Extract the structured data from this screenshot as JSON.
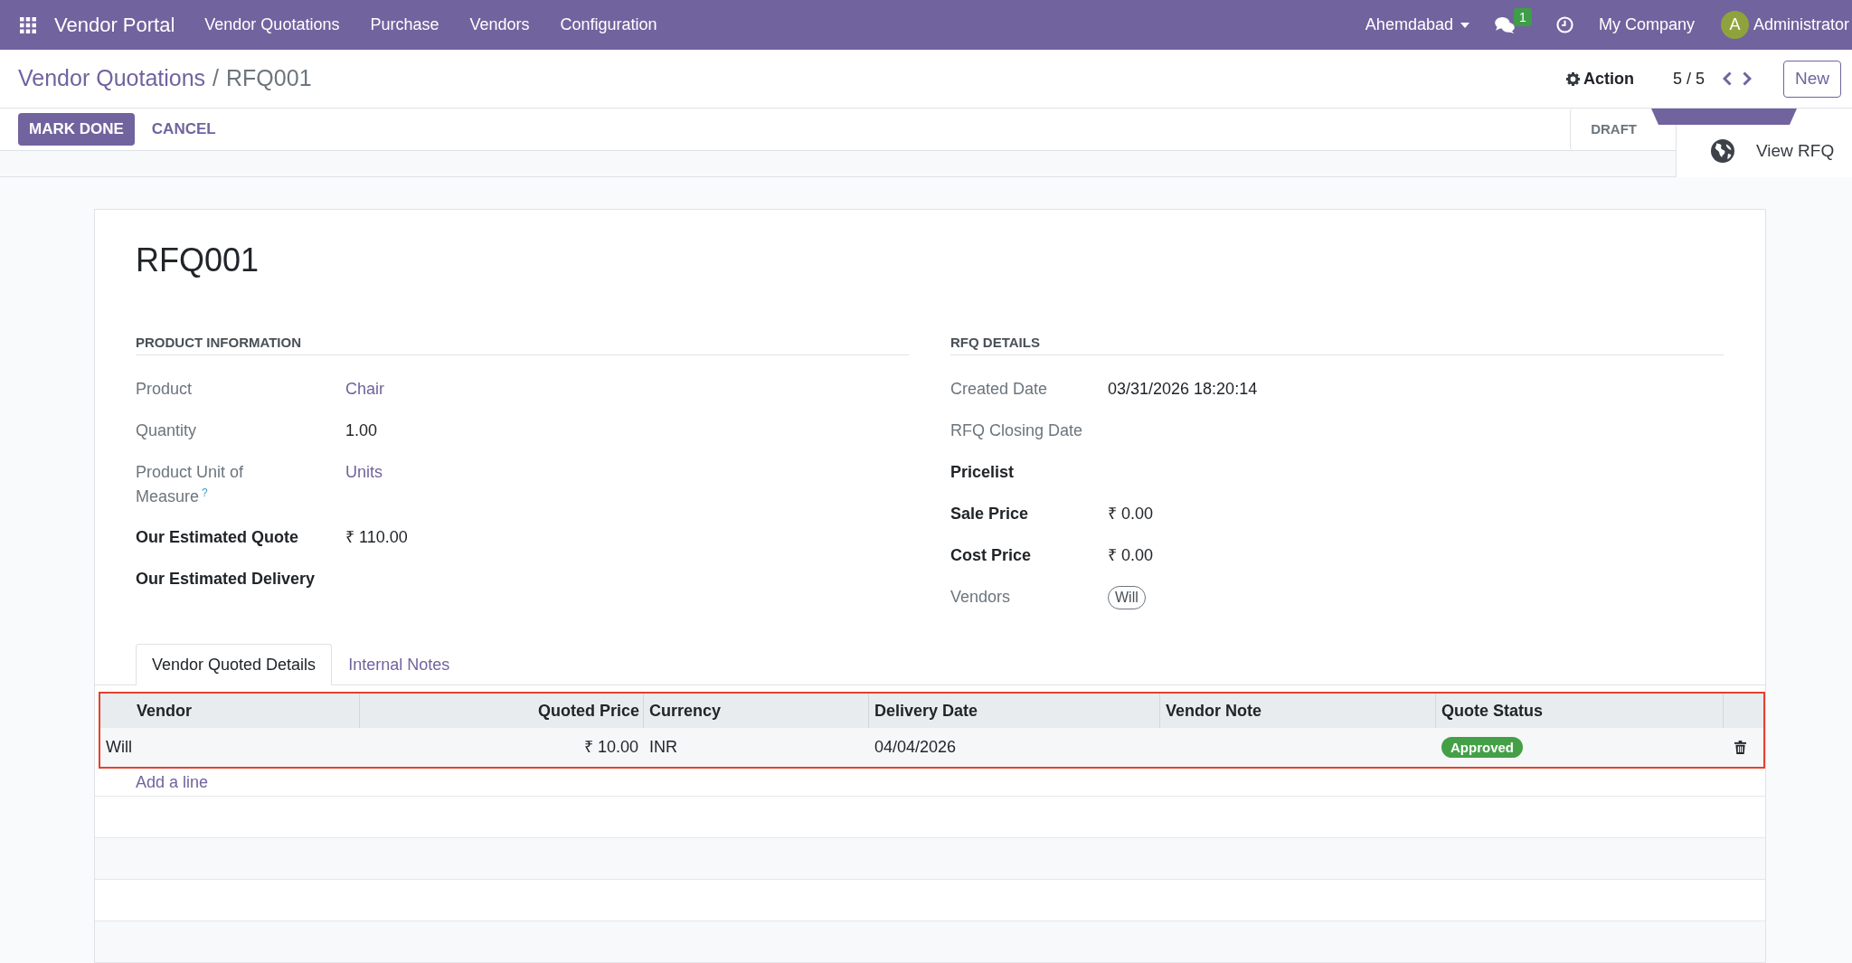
{
  "navbar": {
    "brand": "Vendor Portal",
    "menu": [
      "Vendor Quotations",
      "Purchase",
      "Vendors",
      "Configuration"
    ],
    "company_switcher": "Ahemdabad",
    "messages_count": "1",
    "company": "My Company",
    "user": {
      "initial": "A",
      "name": "Administrator"
    }
  },
  "breadcrumb": {
    "items": [
      {
        "label": "Vendor Quotations",
        "kind": "link"
      },
      {
        "label": "RFQ001",
        "kind": "current"
      }
    ],
    "separator": "/"
  },
  "action_menu": "Action",
  "pager": "5 / 5",
  "new_button": "New",
  "header_buttons": [
    {
      "label": "MARK DONE",
      "kind": "primary"
    },
    {
      "label": "CANCEL",
      "kind": "secondary"
    }
  ],
  "statusbar": [
    {
      "label": "DRAFT",
      "selected": false
    },
    {
      "selected": true
    }
  ],
  "smart_buttons": [
    {
      "label": "View RFQ"
    }
  ],
  "sheet": {
    "title": "RFQ001",
    "groups": [
      {
        "heading": "PRODUCT INFORMATION",
        "fields": [
          {
            "label": "Product",
            "emphasized": false,
            "kind": "link",
            "value": "Chair"
          },
          {
            "label": "Quantity",
            "emphasized": false,
            "kind": "text",
            "value": "1.00"
          },
          {
            "label": "Product Unit of Measure$^{?}$",
            "emphasized": false,
            "kind": "link",
            "value": "Units"
          },
          {
            "label": "Our Estimated Quote",
            "emphasized": true,
            "kind": "text",
            "value": "₹ 110.00"
          },
          {
            "label": "Our Estimated Delivery",
            "emphasized": true
          }
        ]
      },
      {
        "heading": "RFQ DETAILS",
        "fields": [
          {
            "label": "Created Date",
            "emphasized": false,
            "kind": "text",
            "value": "03/31/2026 18:20:14"
          },
          {
            "label": "RFQ Closing Date",
            "emphasized": false
          },
          {
            "label": "Pricelist",
            "emphasized": true
          },
          {
            "label": "Sale Price",
            "emphasized": true,
            "kind": "text",
            "value": "₹ 0.00"
          },
          {
            "label": "Cost Price",
            "emphasized": true,
            "kind": "text",
            "value": "₹ 0.00"
          },
          {
            "label": "Vendors",
            "emphasized": false,
            "kind": "tags",
            "tags": [
              "Will"
            ]
          }
        ]
      }
    ]
  },
  "notebook": {
    "tabs": [
      {
        "label": "Vendor Quoted Details",
        "selected": true
      },
      {
        "label": "Internal Notes",
        "selected": false
      }
    ],
    "table": {
      "highlighted": true,
      "columns": [
        "Vendor",
        "Quoted Price",
        "Currency",
        "Delivery Date",
        "Vendor Note",
        "Quote Status"
      ],
      "rows": [
        {
          "vendor": "Will",
          "quoted_price": "₹ 10.00",
          "currency": "INR",
          "delivery_date": "04/04/2026",
          "quote_status": {
            "label": "Approved",
            "kind": "success"
          }
        }
      ],
      "add_line": "Add a line"
    }
  }
}
